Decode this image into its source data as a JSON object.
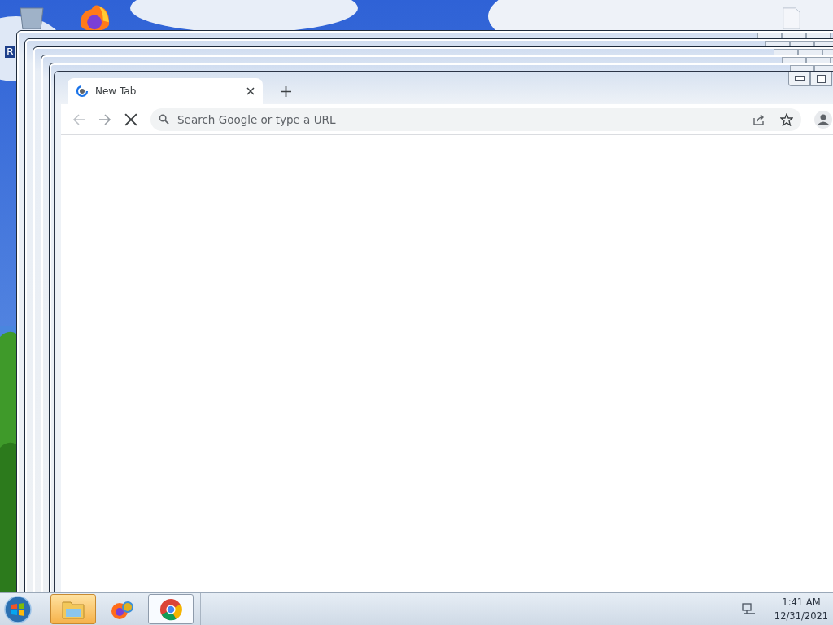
{
  "desktop": {
    "icons": [
      {
        "kind": "recycle-bin",
        "label": "R"
      },
      {
        "kind": "firefox"
      },
      {
        "kind": "file"
      }
    ]
  },
  "browser": {
    "tabs": [
      {
        "label": "New Tab",
        "selected": true
      }
    ],
    "omnibox": {
      "placeholder": "Search Google or type a URL"
    },
    "loading": true
  },
  "taskbar": {
    "apps": [
      {
        "kind": "explorer",
        "selected": false,
        "flashing": true
      },
      {
        "kind": "firefox",
        "selected": false,
        "flashing": false
      },
      {
        "kind": "chrome",
        "selected": true,
        "flashing": false
      }
    ],
    "clock": {
      "time": "1:41 AM",
      "date": "12/31/2021"
    }
  }
}
